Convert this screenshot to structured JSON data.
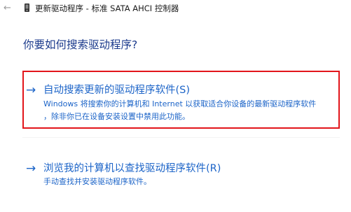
{
  "window": {
    "back_icon": "back-arrow-icon",
    "back_glyph": "←",
    "device_icon": "device-manager-icon",
    "title": "更新驱动程序 - 标准 SATA AHCI 控制器"
  },
  "main": {
    "question": "你要如何搜索驱动程序?",
    "arrow_glyph": "→",
    "options": [
      {
        "title": "自动搜索更新的驱动程序软件(S)",
        "description_line1": "Windows 将搜索你的计算机和 Internet 以获取适合你设备的最新驱动程序软件",
        "description_line2": "，除非你已在设备安装设置中禁用此功能。",
        "selected": true
      },
      {
        "title": "浏览我的计算机以查找驱动程序软件(R)",
        "description_line1": "手动查找并安装驱动程序软件。",
        "selected": false
      }
    ]
  },
  "colors": {
    "link_blue": "#1c64c8",
    "heading_blue": "#1b3a8c",
    "selection_border": "#e2151b"
  }
}
